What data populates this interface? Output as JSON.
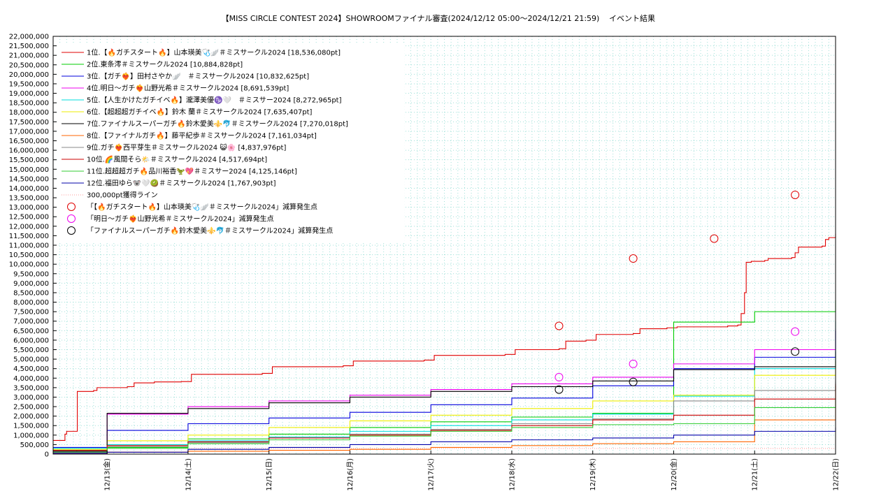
{
  "chart_data": {
    "type": "line",
    "title": "【MISS CIRCLE CONTEST 2024】SHOWROOMファイナル審査(2024/12/12 05:00～2024/12/21 21:59)",
    "subtitle": "イベント結果",
    "xlabel": "",
    "ylabel": "",
    "ylim": [
      0,
      22000000
    ],
    "yticks": [
      0,
      500000,
      1000000,
      1500000,
      2000000,
      2500000,
      3000000,
      3500000,
      4000000,
      4500000,
      5000000,
      5500000,
      6000000,
      6500000,
      7000000,
      7500000,
      8000000,
      8500000,
      9000000,
      9500000,
      10000000,
      10500000,
      11000000,
      11500000,
      12000000,
      12500000,
      13000000,
      13500000,
      14000000,
      14500000,
      15000000,
      15500000,
      16000000,
      16500000,
      17000000,
      17500000,
      18000000,
      18500000,
      19000000,
      19500000,
      20000000,
      20500000,
      21000000,
      21500000,
      22000000
    ],
    "ytick_labels": [
      "0",
      "500,000",
      "1,000,000",
      "1,500,000",
      "2,000,000",
      "2,500,000",
      "3,000,000",
      "3,500,000",
      "4,000,000",
      "4,500,000",
      "5,000,000",
      "5,500,000",
      "6,000,000",
      "6,500,000",
      "7,000,000",
      "7,500,000",
      "8,000,000",
      "8,500,000",
      "9,000,000",
      "9,500,000",
      "10,000,000",
      "10,500,000",
      "11,000,000",
      "11,500,000",
      "12,000,000",
      "12,500,000",
      "13,000,000",
      "13,500,000",
      "14,000,000",
      "14,500,000",
      "15,000,000",
      "15,500,000",
      "16,000,000",
      "16,500,000",
      "17,000,000",
      "17,500,000",
      "18,000,000",
      "18,500,000",
      "19,000,000",
      "19,500,000",
      "20,000,000",
      "20,500,000",
      "21,000,000",
      "21,500,000",
      "22,000,000"
    ],
    "xlim": [
      "2024-12-12 08:00",
      "2024-12-22 00:00"
    ],
    "xticks": [
      {
        "x": "2024-12-13 00:00",
        "label": "12/13(金)"
      },
      {
        "x": "2024-12-14 00:00",
        "label": "12/14(土)"
      },
      {
        "x": "2024-12-15 00:00",
        "label": "12/15(日)"
      },
      {
        "x": "2024-12-16 00:00",
        "label": "12/16(月)"
      },
      {
        "x": "2024-12-17 00:00",
        "label": "12/17(火)"
      },
      {
        "x": "2024-12-18 00:00",
        "label": "12/18(水)"
      },
      {
        "x": "2024-12-19 00:00",
        "label": "12/19(木)"
      },
      {
        "x": "2024-12-20 00:00",
        "label": "12/20(金)"
      },
      {
        "x": "2024-12-21 00:00",
        "label": "12/21(土)"
      },
      {
        "x": "2024-12-22 00:00",
        "label": "12/22(日)"
      }
    ],
    "grid": true,
    "legend_position": "top-left",
    "series": [
      {
        "name": "1位.【🔥ガチスタート🔥】山本瑛美🩺🪽＃ミスサークル2024 [18,536,080pt]",
        "color": "#e00000",
        "points": [
          [
            "2024-12-12 08:00",
            720000
          ],
          [
            "2024-12-12 11:00",
            720000
          ],
          [
            "2024-12-12 11:30",
            1050000
          ],
          [
            "2024-12-12 12:00",
            1200000
          ],
          [
            "2024-12-12 15:00",
            1200000
          ],
          [
            "2024-12-12 15:10",
            3300000
          ],
          [
            "2024-12-12 20:00",
            3350000
          ],
          [
            "2024-12-12 21:00",
            3500000
          ],
          [
            "2024-12-13 06:00",
            3550000
          ],
          [
            "2024-12-13 08:00",
            3750000
          ],
          [
            "2024-12-13 14:00",
            3800000
          ],
          [
            "2024-12-13 22:00",
            3820000
          ],
          [
            "2024-12-14 01:00",
            4200000
          ],
          [
            "2024-12-14 22:00",
            4250000
          ],
          [
            "2024-12-15 01:00",
            4600000
          ],
          [
            "2024-12-15 22:00",
            4650000
          ],
          [
            "2024-12-16 01:00",
            4900000
          ],
          [
            "2024-12-16 22:00",
            4950000
          ],
          [
            "2024-12-17 01:00",
            5200000
          ],
          [
            "2024-12-17 22:00",
            5250000
          ],
          [
            "2024-12-18 01:00",
            5500000
          ],
          [
            "2024-12-18 14:00",
            5550000
          ],
          [
            "2024-12-18 16:00",
            5950000
          ],
          [
            "2024-12-18 22:00",
            6000000
          ],
          [
            "2024-12-19 01:00",
            6300000
          ],
          [
            "2024-12-19 12:00",
            6350000
          ],
          [
            "2024-12-19 14:00",
            6600000
          ],
          [
            "2024-12-19 22:00",
            6650000
          ],
          [
            "2024-12-20 01:00",
            6700000
          ],
          [
            "2024-12-20 16:00",
            6750000
          ],
          [
            "2024-12-20 19:00",
            6800000
          ],
          [
            "2024-12-20 20:00",
            7400000
          ],
          [
            "2024-12-20 21:00",
            8500000
          ],
          [
            "2024-12-20 21:30",
            10100000
          ],
          [
            "2024-12-20 23:00",
            10150000
          ],
          [
            "2024-12-21 03:00",
            10200000
          ],
          [
            "2024-12-21 04:00",
            10300000
          ],
          [
            "2024-12-21 11:00",
            10350000
          ],
          [
            "2024-12-21 12:00",
            10600000
          ],
          [
            "2024-12-21 13:00",
            10900000
          ],
          [
            "2024-12-21 20:00",
            10950000
          ],
          [
            "2024-12-21 21:00",
            11300000
          ],
          [
            "2024-12-21 22:00",
            11400000
          ],
          [
            "2024-12-22 00:00",
            11600000
          ]
        ]
      },
      {
        "name": "2位.東条澪＃ミスサークル2024 [10,884,828pt]",
        "color": "#00cc00",
        "points": [
          [
            "2024-12-12 08:00",
            150000
          ],
          [
            "2024-12-12 15:00",
            200000
          ],
          [
            "2024-12-13 00:00",
            350000
          ],
          [
            "2024-12-14 00:00",
            800000
          ],
          [
            "2024-12-15 00:00",
            1050000
          ],
          [
            "2024-12-16 00:00",
            1400000
          ],
          [
            "2024-12-17 00:00",
            1700000
          ],
          [
            "2024-12-18 00:00",
            1950000
          ],
          [
            "2024-12-19 00:00",
            2150000
          ],
          [
            "2024-12-20 00:00",
            6950000
          ],
          [
            "2024-12-21 00:00",
            7500000
          ],
          [
            "2024-12-22 00:00",
            8100000
          ]
        ]
      },
      {
        "name": "3位.【ガチ❤️‍🔥】田村さやか🪽　＃ミスサークル2024 [10,832,625pt]",
        "color": "#0000dd",
        "points": [
          [
            "2024-12-12 08:00",
            350000
          ],
          [
            "2024-12-13 00:00",
            1250000
          ],
          [
            "2024-12-14 00:00",
            1600000
          ],
          [
            "2024-12-15 00:00",
            1900000
          ],
          [
            "2024-12-16 00:00",
            2200000
          ],
          [
            "2024-12-17 00:00",
            2600000
          ],
          [
            "2024-12-18 00:00",
            2950000
          ],
          [
            "2024-12-19 00:00",
            3600000
          ],
          [
            "2024-12-20 00:00",
            4500000
          ],
          [
            "2024-12-21 00:00",
            5100000
          ],
          [
            "2024-12-22 00:00",
            6500000
          ]
        ]
      },
      {
        "name": "4位.明日〜ガチ❤️‍🔥山野光希＃ミスサークル2024 [8,691,539pt]",
        "color": "#ee00ee",
        "points": [
          [
            "2024-12-12 08:00",
            100000
          ],
          [
            "2024-12-13 00:00",
            2100000
          ],
          [
            "2024-12-14 00:00",
            2500000
          ],
          [
            "2024-12-15 00:00",
            2800000
          ],
          [
            "2024-12-16 00:00",
            3100000
          ],
          [
            "2024-12-17 00:00",
            3400000
          ],
          [
            "2024-12-18 00:00",
            3700000
          ],
          [
            "2024-12-19 00:00",
            4050000
          ],
          [
            "2024-12-20 00:00",
            4750000
          ],
          [
            "2024-12-21 00:00",
            5500000
          ],
          [
            "2024-12-22 00:00",
            6600000
          ]
        ]
      },
      {
        "name": "5位.【人生かけたガチイベ🔥】瀧澤美優♑️🤍　＃ミスサー2024 [8,272,965pt]",
        "color": "#00dddd",
        "points": [
          [
            "2024-12-12 08:00",
            300000
          ],
          [
            "2024-12-13 00:00",
            500000
          ],
          [
            "2024-12-14 00:00",
            700000
          ],
          [
            "2024-12-15 00:00",
            900000
          ],
          [
            "2024-12-16 00:00",
            1200000
          ],
          [
            "2024-12-17 00:00",
            1500000
          ],
          [
            "2024-12-18 00:00",
            1800000
          ],
          [
            "2024-12-19 00:00",
            2100000
          ],
          [
            "2024-12-20 00:00",
            3050000
          ],
          [
            "2024-12-21 00:00",
            4500000
          ],
          [
            "2024-12-22 00:00",
            7000000
          ]
        ]
      },
      {
        "name": "6位.【超超超ガチイベ🔥】鈴木 蘭＃ミスサークル2024 [7,635,407pt]",
        "color": "#eeee00",
        "points": [
          [
            "2024-12-12 08:00",
            250000
          ],
          [
            "2024-12-13 00:00",
            700000
          ],
          [
            "2024-12-14 00:00",
            1000000
          ],
          [
            "2024-12-15 00:00",
            1400000
          ],
          [
            "2024-12-16 00:00",
            1750000
          ],
          [
            "2024-12-17 00:00",
            2050000
          ],
          [
            "2024-12-18 00:00",
            2400000
          ],
          [
            "2024-12-19 00:00",
            2800000
          ],
          [
            "2024-12-20 00:00",
            3100000
          ],
          [
            "2024-12-21 00:00",
            4150000
          ],
          [
            "2024-12-22 00:00",
            4900000
          ]
        ]
      },
      {
        "name": "7位.ファイナルスーパーガチ🔥鈴木愛美⚜️🐬＃ミスサークル2024 [7,270,018pt]",
        "color": "#000000",
        "points": [
          [
            "2024-12-12 08:00",
            150000
          ],
          [
            "2024-12-13 00:00",
            2150000
          ],
          [
            "2024-12-14 00:00",
            2400000
          ],
          [
            "2024-12-15 00:00",
            2700000
          ],
          [
            "2024-12-16 00:00",
            3000000
          ],
          [
            "2024-12-17 00:00",
            3300000
          ],
          [
            "2024-12-18 00:00",
            3550000
          ],
          [
            "2024-12-19 00:00",
            3850000
          ],
          [
            "2024-12-20 00:00",
            4450000
          ],
          [
            "2024-12-21 00:00",
            4600000
          ],
          [
            "2024-12-22 00:00",
            5400000
          ]
        ]
      },
      {
        "name": "8位.【ファイナルガチ🔥】藤平紀歩＃ミスサークル2024 [7,161,034pt]",
        "color": "#ff6600",
        "points": [
          [
            "2024-12-12 08:00",
            50000
          ],
          [
            "2024-12-13 00:00",
            100000
          ],
          [
            "2024-12-14 00:00",
            150000
          ],
          [
            "2024-12-15 00:00",
            200000
          ],
          [
            "2024-12-16 00:00",
            250000
          ],
          [
            "2024-12-17 00:00",
            350000
          ],
          [
            "2024-12-18 00:00",
            450000
          ],
          [
            "2024-12-19 00:00",
            550000
          ],
          [
            "2024-12-20 00:00",
            650000
          ],
          [
            "2024-12-21 00:00",
            1800000
          ],
          [
            "2024-12-22 00:00",
            3600000
          ]
        ]
      },
      {
        "name": "9位.ガチ❤️‍🔥西平芽生＃ミスサークル2024 😺🌸 [4,837,976pt]",
        "color": "#888888",
        "points": [
          [
            "2024-12-12 08:00",
            200000
          ],
          [
            "2024-12-13 00:00",
            400000
          ],
          [
            "2024-12-14 00:00",
            600000
          ],
          [
            "2024-12-15 00:00",
            850000
          ],
          [
            "2024-12-16 00:00",
            1050000
          ],
          [
            "2024-12-17 00:00",
            1300000
          ],
          [
            "2024-12-18 00:00",
            1600000
          ],
          [
            "2024-12-19 00:00",
            1850000
          ],
          [
            "2024-12-20 00:00",
            2800000
          ],
          [
            "2024-12-21 00:00",
            3350000
          ],
          [
            "2024-12-22 00:00",
            3800000
          ]
        ]
      },
      {
        "name": "10位.🌈風間そら🌤️＃ミスサークル2024 [4,517,694pt]",
        "color": "#cc0000",
        "points": [
          [
            "2024-12-12 08:00",
            200000
          ],
          [
            "2024-12-13 00:00",
            450000
          ],
          [
            "2024-12-14 00:00",
            650000
          ],
          [
            "2024-12-15 00:00",
            850000
          ],
          [
            "2024-12-16 00:00",
            1000000
          ],
          [
            "2024-12-17 00:00",
            1250000
          ],
          [
            "2024-12-18 00:00",
            1500000
          ],
          [
            "2024-12-19 00:00",
            1800000
          ],
          [
            "2024-12-20 00:00",
            2050000
          ],
          [
            "2024-12-21 00:00",
            2900000
          ],
          [
            "2024-12-22 00:00",
            3700000
          ]
        ]
      },
      {
        "name": "11位.超超超ガチ🔥品川裕香🦖💖＃ミスサー2024 [4,125,146pt]",
        "color": "#33cc33",
        "points": [
          [
            "2024-12-12 08:00",
            100000
          ],
          [
            "2024-12-13 00:00",
            300000
          ],
          [
            "2024-12-14 00:00",
            550000
          ],
          [
            "2024-12-15 00:00",
            750000
          ],
          [
            "2024-12-16 00:00",
            950000
          ],
          [
            "2024-12-17 00:00",
            1200000
          ],
          [
            "2024-12-18 00:00",
            1400000
          ],
          [
            "2024-12-19 00:00",
            1550000
          ],
          [
            "2024-12-20 00:00",
            1600000
          ],
          [
            "2024-12-21 00:00",
            2450000
          ],
          [
            "2024-12-22 00:00",
            2900000
          ]
        ]
      },
      {
        "name": "12位.福田ゆら🐨🤍🥝＃ミスサークル2024 [1,767,903pt]",
        "color": "#0000aa",
        "points": [
          [
            "2024-12-12 08:00",
            50000
          ],
          [
            "2024-12-13 00:00",
            100000
          ],
          [
            "2024-12-14 00:00",
            250000
          ],
          [
            "2024-12-15 00:00",
            350000
          ],
          [
            "2024-12-16 00:00",
            500000
          ],
          [
            "2024-12-17 00:00",
            650000
          ],
          [
            "2024-12-18 00:00",
            750000
          ],
          [
            "2024-12-19 00:00",
            850000
          ],
          [
            "2024-12-20 00:00",
            1000000
          ],
          [
            "2024-12-21 00:00",
            1200000
          ],
          [
            "2024-12-22 00:00",
            1400000
          ]
        ]
      }
    ],
    "threshold_line": {
      "name": "300,000pt獲得ライン",
      "value": 300000,
      "color": "#ff9999",
      "style": "dotted"
    },
    "marker_series": [
      {
        "name": "「【🔥ガチスタート🔥】山本瑛美🩺🪽＃ミスサークル2024」減算発生点",
        "color": "#e00000",
        "points": [
          [
            "2024-12-18 14:00",
            6750000
          ],
          [
            "2024-12-19 12:00",
            10300000
          ],
          [
            "2024-12-20 12:00",
            11350000
          ],
          [
            "2024-12-21 12:00",
            13650000
          ]
        ]
      },
      {
        "name": "「明日〜ガチ❤️‍🔥山野光希＃ミスサークル2024」減算発生点",
        "color": "#ee00ee",
        "points": [
          [
            "2024-12-18 14:00",
            4050000
          ],
          [
            "2024-12-19 12:00",
            4750000
          ],
          [
            "2024-12-21 12:00",
            6450000
          ]
        ]
      },
      {
        "name": "「ファイナルスーパーガチ🔥鈴木愛美⚜️🐬＃ミスサークル2024」減算発生点",
        "color": "#000000",
        "points": [
          [
            "2024-12-18 14:00",
            3400000
          ],
          [
            "2024-12-19 12:00",
            3800000
          ],
          [
            "2024-12-21 12:00",
            5400000
          ]
        ]
      }
    ]
  }
}
